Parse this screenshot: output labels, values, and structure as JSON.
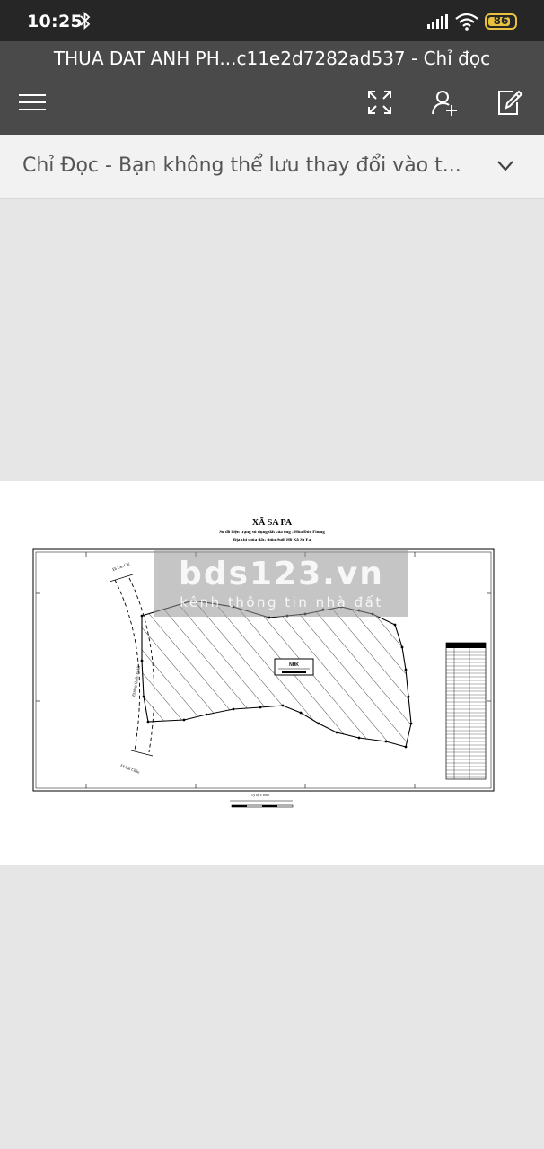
{
  "status_bar": {
    "time": "10:25",
    "battery": "86",
    "battery_level": 0.86,
    "battery_color": "#e8c23f"
  },
  "app_bar": {
    "document_title": "THUA DAT ANH PH...c11e2d7282ad537 - Chỉ đọc",
    "background": "#4a4a4a"
  },
  "read_only_banner": {
    "message": "Chỉ Đọc - Bạn không thể lưu thay đổi vào t..."
  },
  "document": {
    "map_title": "XÃ SA PA",
    "map_subtitle_1": "Sơ đồ hiện trạng sử dụng đất của ông : Hòa Đức Phong",
    "map_subtitle_2": "Địa chỉ thửa đất: thôn Suối Hồ Xã Sa Pa",
    "parcel_label": "NHK",
    "road_label_top": "Đi Lào Cai",
    "road_label_bottom": "Đi Lai Châu",
    "road_label_side": "Đường Quốc lộ 4D",
    "scale_label": "Tỷ lệ 1:1000",
    "watermark_main": "bds123.vn",
    "watermark_sub": "kênh thông tin nhà đất"
  }
}
